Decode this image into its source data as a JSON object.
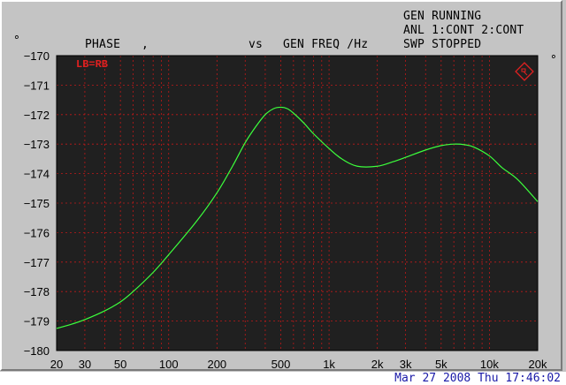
{
  "header": {
    "left_symbol": "°",
    "right_symbol": "°",
    "y_param": "PHASE",
    "separator": ",",
    "vs_label": "vs",
    "x_param": "GEN FREQ /Hz",
    "status_lines": [
      "GEN RUNNING",
      "ANL 1:CONT 2:CONT",
      "SWP STOPPED"
    ]
  },
  "footer": {
    "timestamp": "Mar 27 2008 Thu 17:46:02"
  },
  "colors": {
    "plot_bg": "#202020",
    "grid": "#c01818",
    "trace": "#3cff3c",
    "label_red": "#e02020",
    "window_bg": "#c4c4c4",
    "timestamp": "#1a1aa8"
  },
  "chart_data": {
    "type": "line",
    "title": "",
    "xlabel": "GEN FREQ /Hz",
    "ylabel": "PHASE",
    "x_scale": "log",
    "xlim": [
      20,
      20000
    ],
    "ylim": [
      -180,
      -170
    ],
    "grid": true,
    "trace_label": "LB=RB",
    "x_ticks": [
      {
        "value": 20,
        "label": "20"
      },
      {
        "value": 30,
        "label": "30"
      },
      {
        "value": 50,
        "label": "50"
      },
      {
        "value": 100,
        "label": "100"
      },
      {
        "value": 200,
        "label": "200"
      },
      {
        "value": 500,
        "label": "500"
      },
      {
        "value": 1000,
        "label": "1k"
      },
      {
        "value": 2000,
        "label": "2k"
      },
      {
        "value": 3000,
        "label": "3k"
      },
      {
        "value": 5000,
        "label": "5k"
      },
      {
        "value": 10000,
        "label": "10k"
      },
      {
        "value": 20000,
        "label": "20k"
      }
    ],
    "y_ticks": [
      {
        "value": -170,
        "label": "−170"
      },
      {
        "value": -171,
        "label": "−171"
      },
      {
        "value": -172,
        "label": "−172"
      },
      {
        "value": -173,
        "label": "−173"
      },
      {
        "value": -174,
        "label": "−174"
      },
      {
        "value": -175,
        "label": "−175"
      },
      {
        "value": -176,
        "label": "−176"
      },
      {
        "value": -177,
        "label": "−177"
      },
      {
        "value": -178,
        "label": "−178"
      },
      {
        "value": -179,
        "label": "−179"
      },
      {
        "value": -180,
        "label": "−180"
      }
    ],
    "series": [
      {
        "x": [
          20,
          25,
          30,
          40,
          50,
          60,
          80,
          100,
          150,
          200,
          250,
          300,
          350,
          400,
          450,
          500,
          550,
          600,
          700,
          800,
          1000,
          1200,
          1500,
          2000,
          2500,
          3000,
          4000,
          5000,
          6000,
          7000,
          8000,
          10000,
          12000,
          15000,
          20000
        ],
        "y": [
          -179.25,
          -179.1,
          -178.95,
          -178.65,
          -178.35,
          -178.0,
          -177.35,
          -176.75,
          -175.6,
          -174.65,
          -173.75,
          -172.95,
          -172.4,
          -172.0,
          -171.8,
          -171.75,
          -171.8,
          -171.95,
          -172.3,
          -172.65,
          -173.15,
          -173.5,
          -173.75,
          -173.75,
          -173.6,
          -173.45,
          -173.2,
          -173.05,
          -173.0,
          -173.02,
          -173.1,
          -173.4,
          -173.8,
          -174.2,
          -174.95
        ]
      }
    ]
  }
}
